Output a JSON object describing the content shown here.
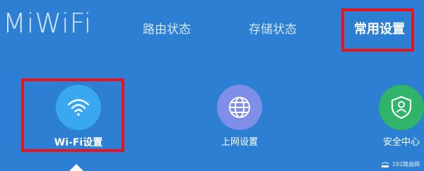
{
  "header": {
    "logo": "MiWiFi",
    "nav": [
      {
        "label": "路由状态",
        "active": false
      },
      {
        "label": "存储状态",
        "active": false
      },
      {
        "label": "常用设置",
        "active": true
      }
    ]
  },
  "tiles": [
    {
      "label": "Wi-Fi设置",
      "icon": "wifi-icon",
      "color": "#3aa8f0",
      "selected": true
    },
    {
      "label": "上网设置",
      "icon": "globe-icon",
      "color": "#7f8ee6",
      "selected": false
    },
    {
      "label": "安全中心",
      "icon": "shield-user-icon",
      "color": "#2fb46a",
      "selected": false
    }
  ],
  "watermark": "192路由网",
  "colors": {
    "background": "#2c7fd2",
    "highlight": "#e8141c"
  }
}
